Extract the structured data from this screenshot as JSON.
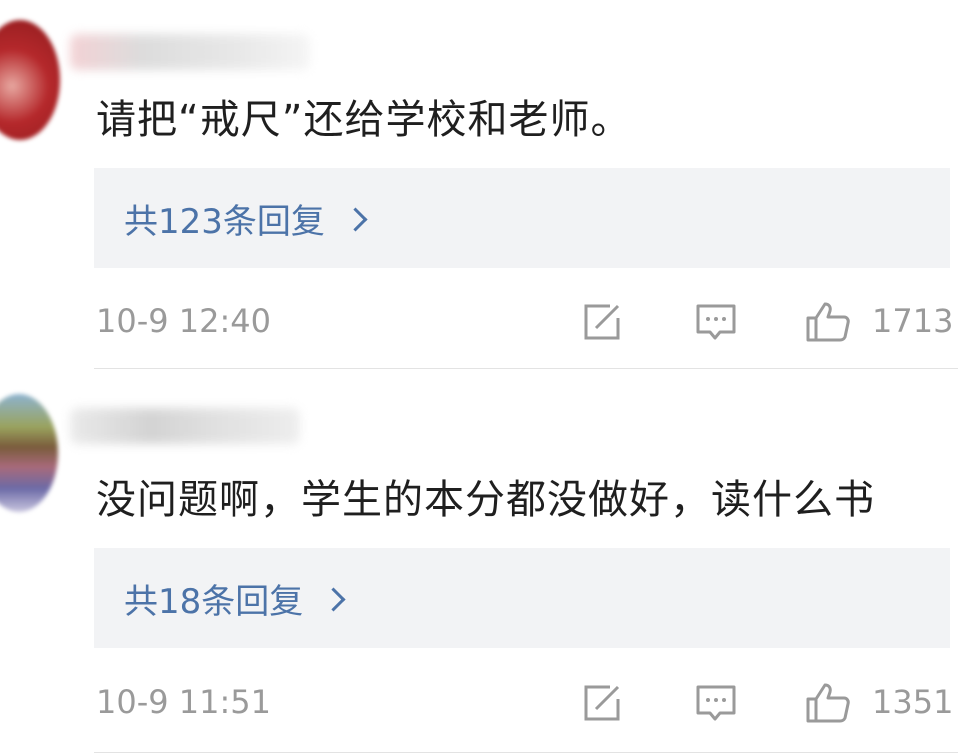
{
  "comments": [
    {
      "text": "请把“戒尺”还给学校和老师。",
      "reply_label": "共123条回复",
      "timestamp": "10-9 12:40",
      "likes": "1713"
    },
    {
      "text": "没问题啊，学生的本分都没做好，读什么书",
      "reply_label": "共18条回复",
      "timestamp": "10-9 11:51",
      "likes": "1351"
    }
  ],
  "icons": {
    "share": "share-edit-icon",
    "reply": "comment-bubble-icon",
    "like": "thumbs-up-icon",
    "chevron": "chevron-right-icon"
  },
  "colors": {
    "reply_link": "#4c73a8",
    "reply_box_bg": "#f2f3f5",
    "meta_text": "#9a9a9a",
    "comment_text": "#1f1f1f"
  }
}
